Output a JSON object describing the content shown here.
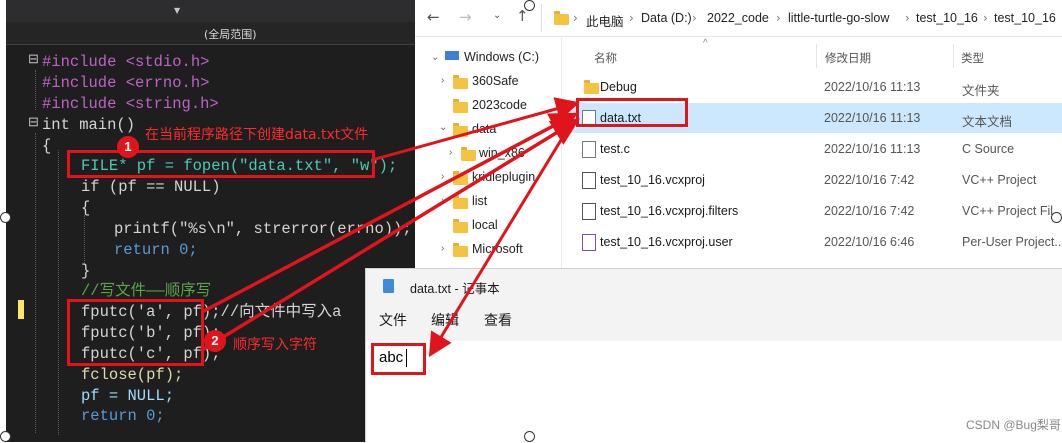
{
  "editor": {
    "scope_label": "(全局范围)",
    "code_lines": [
      "#include <stdio.h>",
      "#include <errno.h>",
      "#include <string.h>",
      "int main()",
      "{",
      "FILE* pf = fopen(\"data.txt\", \"w\");",
      "if (pf == NULL)",
      "{",
      "printf(\"%s\\n\", strerror(errno));",
      "return 0;",
      "}",
      "//写文件——顺序写",
      "fputc('a', pf);//向文件中写入a",
      "fputc('b', pf);",
      "fputc('c', pf);",
      "fclose(pf);",
      "pf = NULL;",
      "return 0;"
    ]
  },
  "explorer": {
    "breadcrumb": [
      "此电脑",
      "Data (D:)",
      "2022_code",
      "little-turtle-go-slow",
      "test_10_16",
      "test_10_16"
    ],
    "tree": [
      {
        "label": "Windows (C:)",
        "chevron": "down"
      },
      {
        "label": "360Safe",
        "chevron": "right"
      },
      {
        "label": "2023code",
        "chevron": ""
      },
      {
        "label": "data",
        "chevron": "down"
      },
      {
        "label": "win_x86",
        "chevron": "right"
      },
      {
        "label": "kridleplugin",
        "chevron": "right"
      },
      {
        "label": "list",
        "chevron": "right"
      },
      {
        "label": "local",
        "chevron": ""
      },
      {
        "label": "Microsoft",
        "chevron": "right"
      }
    ],
    "columns": {
      "name": "名称",
      "date": "修改日期",
      "type": "类型"
    },
    "files": [
      {
        "name": "Debug",
        "date": "2022/10/16 11:13",
        "type": "文件夹",
        "icon": "folder-icon"
      },
      {
        "name": "data.txt",
        "date": "2022/10/16 11:13",
        "type": "文本文档",
        "icon": "text-file-icon"
      },
      {
        "name": "test.c",
        "date": "2022/10/16 11:13",
        "type": "C Source",
        "icon": "c-file-icon"
      },
      {
        "name": "test_10_16.vcxproj",
        "date": "2022/10/16 7:42",
        "type": "VC++ Project",
        "icon": "vcxproj-file-icon"
      },
      {
        "name": "test_10_16.vcxproj.filters",
        "date": "2022/10/16 7:42",
        "type": "VC++ Project Fil",
        "icon": "filters-file-icon"
      },
      {
        "name": "test_10_16.vcxproj.user",
        "date": "2022/10/16 6:46",
        "type": "Per-User Project...",
        "icon": "user-file-icon"
      }
    ]
  },
  "notepad": {
    "title": "data.txt - 记事本",
    "menu": [
      "文件",
      "编辑",
      "查看"
    ],
    "content": "abc"
  },
  "annotations": {
    "step1_badge": "1",
    "step1_text": "在当前程序路径下创建data.txt文件",
    "step2_badge": "2",
    "step2_text": "顺序写入字符",
    "color": "#e0151b"
  },
  "watermark": "CSDN @Bug梨哥"
}
